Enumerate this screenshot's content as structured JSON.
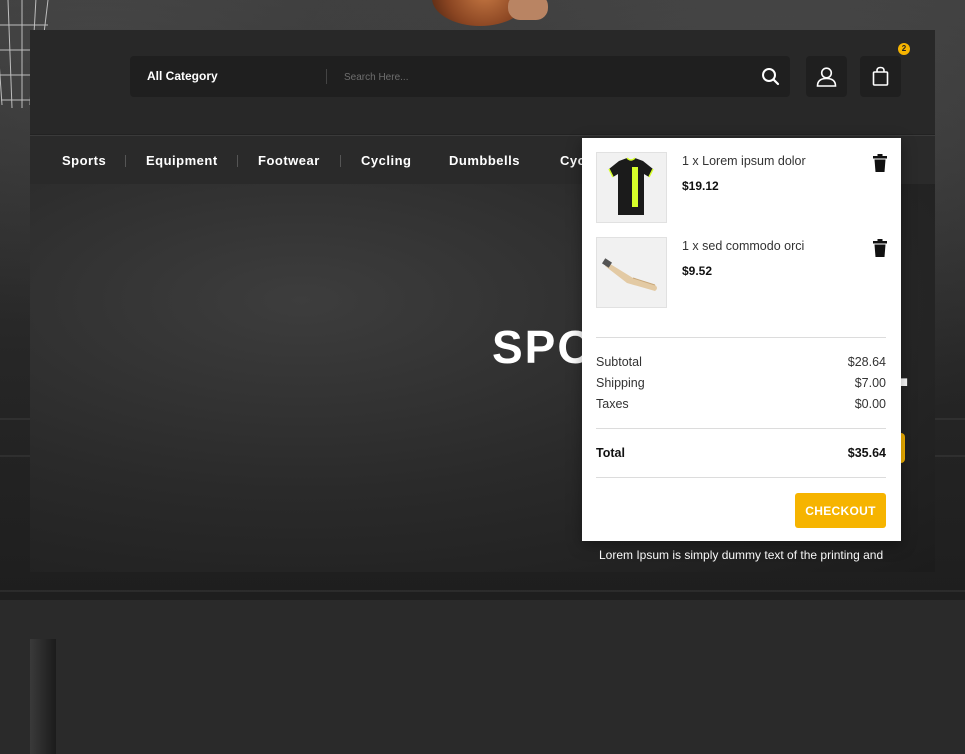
{
  "header": {
    "category_label": "All Category",
    "search_placeholder": "Search Here...",
    "cart_count": "2"
  },
  "nav": {
    "items": [
      {
        "label": "Sports"
      },
      {
        "label": "Equipment"
      },
      {
        "label": "Footwear"
      },
      {
        "label": "Cycling"
      },
      {
        "label": "Dumbbells"
      },
      {
        "label": "Cyc"
      }
    ]
  },
  "hero": {
    "title": "SPO",
    "subtitle": "Lorem Ipsum is simply dummy text of the printing and"
  },
  "cart": {
    "items": [
      {
        "name": "1 x Lorem ipsum dolor",
        "price": "$19.12",
        "image": "jersey-icon"
      },
      {
        "name": "1 x sed commodo orci",
        "price": "$9.52",
        "image": "cricket-bat-icon"
      }
    ],
    "summary": {
      "subtotal_label": "Subtotal",
      "subtotal_value": "$28.64",
      "shipping_label": "Shipping",
      "shipping_value": "$7.00",
      "taxes_label": "Taxes",
      "taxes_value": "$0.00",
      "total_label": "Total",
      "total_value": "$35.64"
    },
    "checkout_label": "CHECKOUT"
  },
  "colors": {
    "accent": "#f6b400",
    "header_bg": "#282828",
    "panel_bg": "#222222"
  }
}
